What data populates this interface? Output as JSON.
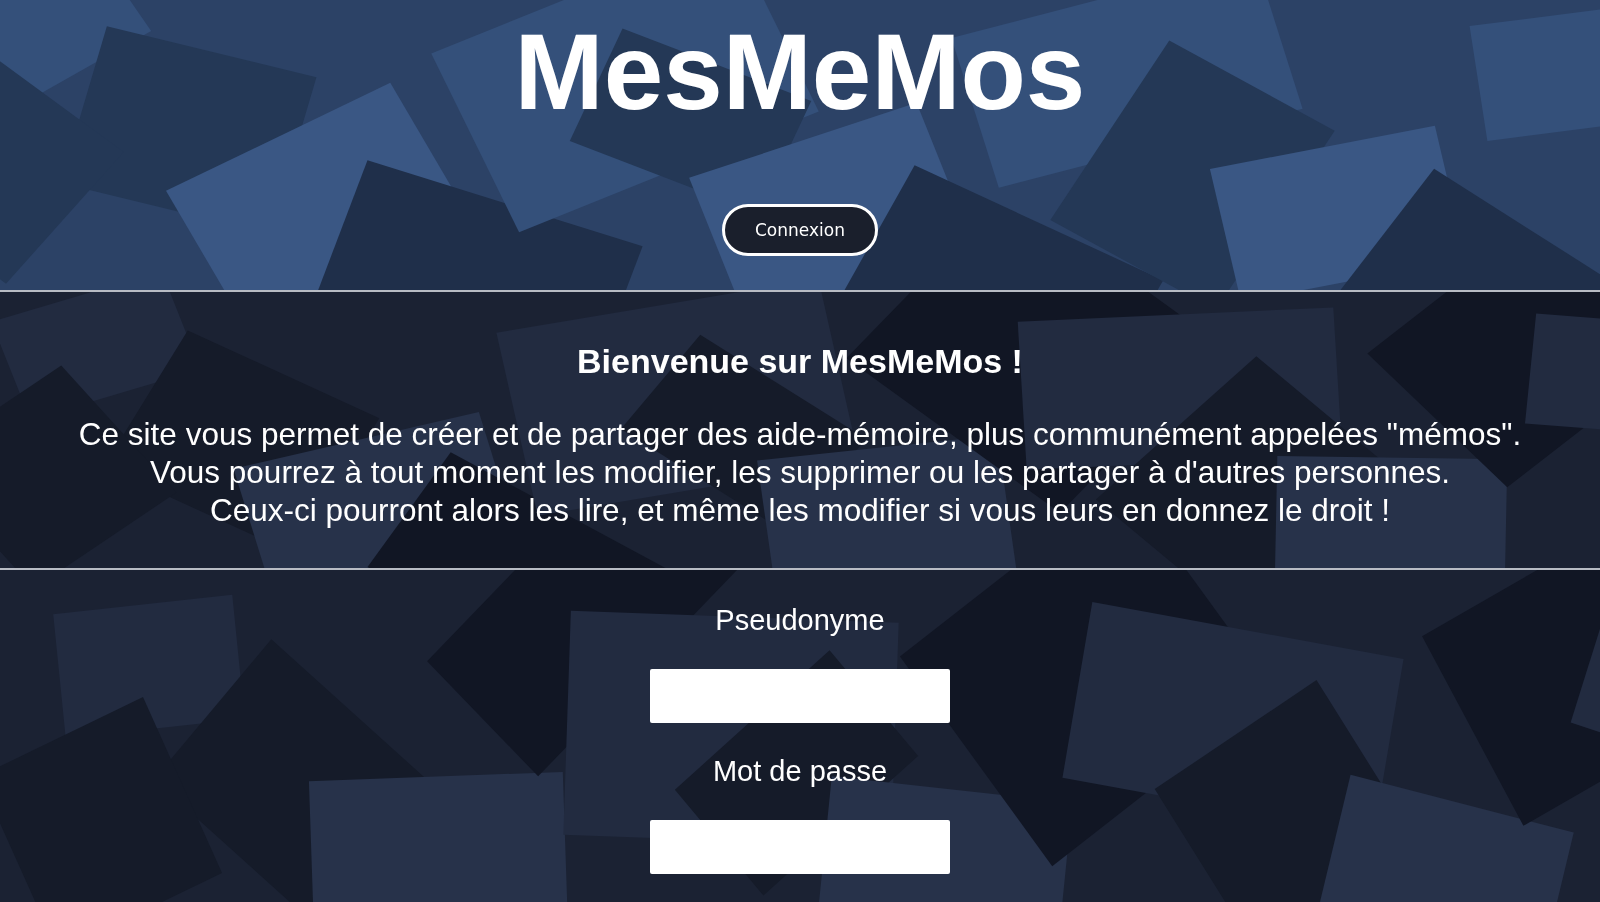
{
  "header": {
    "title": "MesMeMos",
    "button": "Connexion"
  },
  "intro": {
    "heading": "Bienvenue sur MesMeMos !",
    "lines": [
      "Ce site vous permet de créer et de partager des aide-mémoire, plus communément appelées \"mémos\".",
      "Vous pourrez à tout moment les modifier, les supprimer ou les partager à d'autres personnes.",
      "Ceux-ci pourront alors les lire, et même les modifier si vous leurs en donnez le droit !"
    ]
  },
  "form": {
    "fields": [
      {
        "label": "Pseudonyme"
      },
      {
        "label": "Mot de passe"
      }
    ]
  }
}
